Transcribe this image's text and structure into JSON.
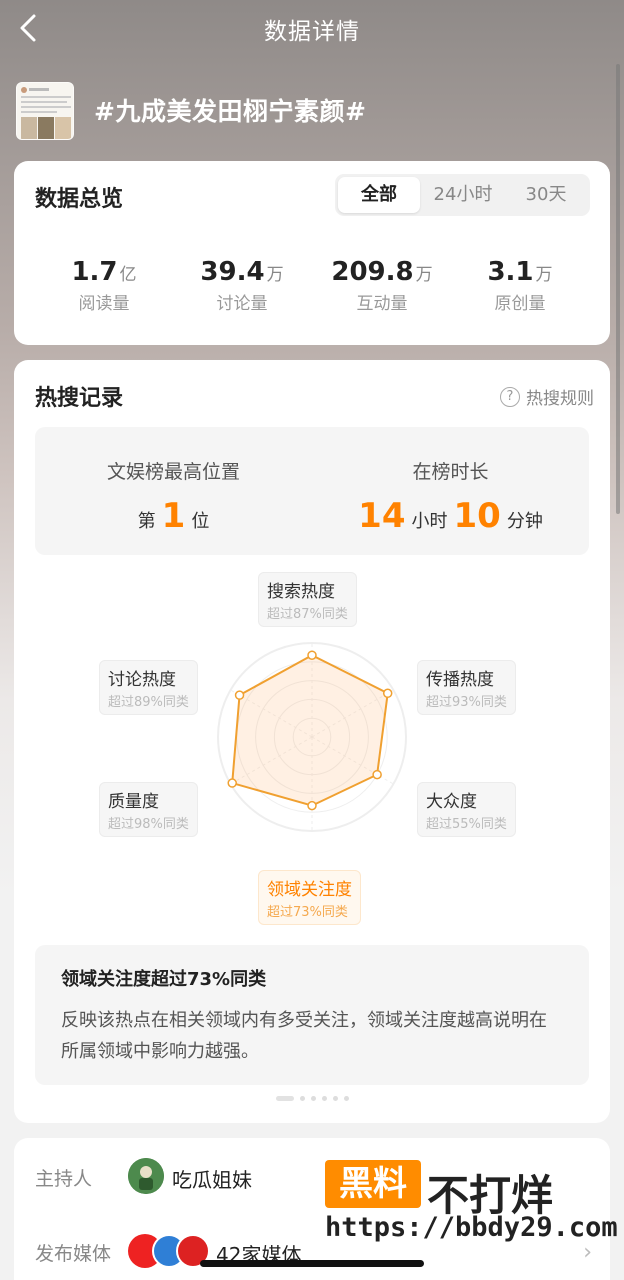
{
  "header": {
    "title": "数据详情"
  },
  "topic": {
    "title": "#九成美发田栩宁素颜#"
  },
  "overview": {
    "title": "数据总览",
    "tabs": [
      {
        "label": "全部",
        "active": true
      },
      {
        "label": "24小时",
        "active": false
      },
      {
        "label": "30天",
        "active": false
      }
    ],
    "stats": [
      {
        "value": "1.7",
        "unit": "亿",
        "label": "阅读量"
      },
      {
        "value": "39.4",
        "unit": "万",
        "label": "讨论量"
      },
      {
        "value": "209.8",
        "unit": "万",
        "label": "互动量"
      },
      {
        "value": "3.1",
        "unit": "万",
        "label": "原创量"
      }
    ]
  },
  "hot_search": {
    "title": "热搜记录",
    "rules_label": "热搜规则",
    "best_rank": {
      "label": "文娱榜最高位置",
      "prefix": "第",
      "value": "1",
      "suffix": "位"
    },
    "duration": {
      "label": "在榜时长",
      "hours": "14",
      "hours_unit": "小时",
      "minutes": "10",
      "minutes_unit": "分钟"
    },
    "radar": [
      {
        "title": "搜索热度",
        "sub": "超过87%同类",
        "value": 0.87,
        "active": false
      },
      {
        "title": "传播热度",
        "sub": "超过93%同类",
        "value": 0.93,
        "active": false
      },
      {
        "title": "大众度",
        "sub": "超过55%同类",
        "value": 0.8,
        "active": false
      },
      {
        "title": "领域关注度",
        "sub": "超过73%同类",
        "value": 0.73,
        "active": true
      },
      {
        "title": "质量度",
        "sub": "超过98%同类",
        "value": 0.98,
        "active": false
      },
      {
        "title": "讨论热度",
        "sub": "超过89%同类",
        "value": 0.89,
        "active": false
      }
    ],
    "radar_color": "#f0a030",
    "desc": {
      "title": "领域关注度超过73%同类",
      "text": "反映该热点在相关领域内有多受关注，领域关注度越高说明在所属领域中影响力越强。"
    }
  },
  "info": {
    "host_label": "主持人",
    "host_name": "吃瓜姐妹",
    "media_label": "发布媒体",
    "media_count": "42家媒体"
  },
  "watermark": {
    "box": "黑料",
    "text": "不打烊",
    "url": "https://bbdy29.com"
  },
  "colors": {
    "accent": "#ff8200"
  }
}
